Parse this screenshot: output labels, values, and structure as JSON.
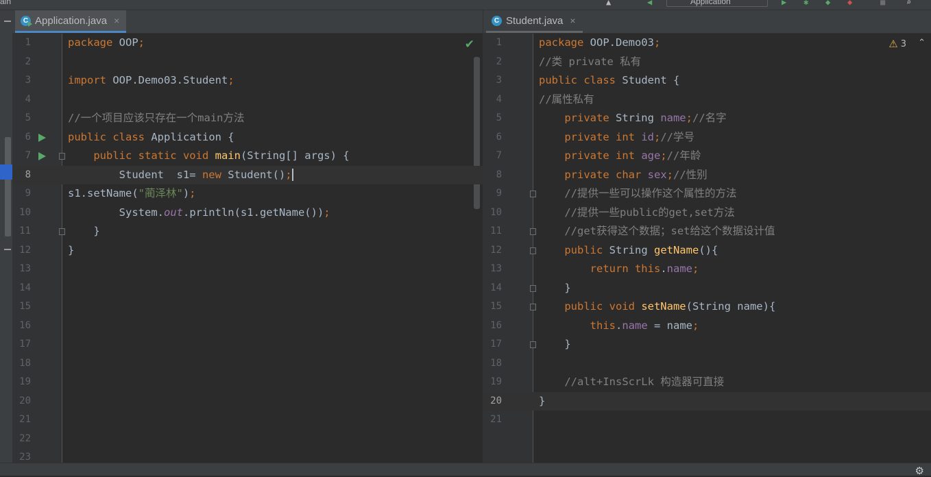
{
  "topbar": {
    "left_fragment": "ain",
    "run_config": "Application",
    "icons": [
      "hammer-icon",
      "back-arrow-icon",
      "run-icon",
      "debug-icon",
      "coverage-icon",
      "profile-icon",
      "stop-icon",
      "search-icon"
    ]
  },
  "left_editor": {
    "tab": {
      "label": "Application.java",
      "icon": "java-class-runnable-icon",
      "active": true
    },
    "status_icon": "check-icon",
    "current_line": 8,
    "run_lines": [
      6,
      7
    ],
    "fold_lines": [
      7,
      11
    ],
    "lines": [
      {
        "n": "1",
        "tokens": [
          [
            "kw",
            "package "
          ],
          [
            "",
            "OOP"
          ],
          [
            "kw",
            ";"
          ]
        ]
      },
      {
        "n": "2",
        "tokens": []
      },
      {
        "n": "3",
        "tokens": [
          [
            "kw",
            "import "
          ],
          [
            "",
            "OOP.Demo03.Student"
          ],
          [
            "kw",
            ";"
          ]
        ]
      },
      {
        "n": "4",
        "tokens": []
      },
      {
        "n": "5",
        "tokens": [
          [
            "cm",
            "//一个项目应该只存在一个main方法"
          ]
        ]
      },
      {
        "n": "6",
        "tokens": [
          [
            "kw",
            "public class "
          ],
          [
            "",
            "Application {"
          ]
        ]
      },
      {
        "n": "7",
        "tokens": [
          [
            "",
            "    "
          ],
          [
            "kw",
            "public static void "
          ],
          [
            "fn",
            "main"
          ],
          [
            "",
            "(String[] args) {"
          ]
        ]
      },
      {
        "n": "8",
        "tokens": [
          [
            "",
            "        Student  s1= "
          ],
          [
            "kw",
            "new "
          ],
          [
            "",
            "Student()"
          ],
          [
            "kw",
            ";"
          ]
        ],
        "caret": true
      },
      {
        "n": "9",
        "tokens": [
          [
            "",
            "s1.setName("
          ],
          [
            "st",
            "\"蔺泽林\""
          ],
          [
            "",
            ")"
          ],
          [
            "kw",
            ";"
          ]
        ]
      },
      {
        "n": "10",
        "tokens": [
          [
            "",
            "        System."
          ],
          [
            "sfld",
            "out"
          ],
          [
            "",
            ".println(s1.getName())"
          ],
          [
            "kw",
            ";"
          ]
        ]
      },
      {
        "n": "11",
        "tokens": [
          [
            "",
            "    }"
          ]
        ]
      },
      {
        "n": "12",
        "tokens": [
          [
            "",
            "}"
          ]
        ]
      },
      {
        "n": "13",
        "tokens": []
      },
      {
        "n": "14",
        "tokens": []
      },
      {
        "n": "15",
        "tokens": []
      },
      {
        "n": "16",
        "tokens": []
      },
      {
        "n": "17",
        "tokens": []
      },
      {
        "n": "18",
        "tokens": []
      },
      {
        "n": "19",
        "tokens": []
      },
      {
        "n": "20",
        "tokens": []
      },
      {
        "n": "21",
        "tokens": []
      },
      {
        "n": "22",
        "tokens": []
      },
      {
        "n": "23",
        "tokens": []
      }
    ]
  },
  "right_editor": {
    "tab": {
      "label": "Student.java",
      "icon": "java-class-icon",
      "active": false
    },
    "warning_count": "3",
    "current_line": 20,
    "run_lines": [],
    "fold_lines": [
      9,
      11,
      12,
      14,
      15,
      17
    ],
    "lines": [
      {
        "n": "1",
        "tokens": [
          [
            "kw",
            "package "
          ],
          [
            "",
            "OOP.Demo03"
          ],
          [
            "kw",
            ";"
          ]
        ]
      },
      {
        "n": "2",
        "tokens": [
          [
            "cm",
            "//类 private 私有"
          ]
        ]
      },
      {
        "n": "3",
        "tokens": [
          [
            "kw",
            "public class "
          ],
          [
            "",
            "Student {"
          ]
        ]
      },
      {
        "n": "4",
        "tokens": [
          [
            "cm",
            "//属性私有"
          ]
        ]
      },
      {
        "n": "5",
        "tokens": [
          [
            "",
            "    "
          ],
          [
            "kw",
            "private "
          ],
          [
            "",
            "String "
          ],
          [
            "fld",
            "name"
          ],
          [
            "kw",
            ";"
          ],
          [
            "cm",
            "//名字"
          ]
        ]
      },
      {
        "n": "6",
        "tokens": [
          [
            "",
            "    "
          ],
          [
            "kw",
            "private int "
          ],
          [
            "fld",
            "id"
          ],
          [
            "kw",
            ";"
          ],
          [
            "cm",
            "//学号"
          ]
        ]
      },
      {
        "n": "7",
        "tokens": [
          [
            "",
            "    "
          ],
          [
            "kw",
            "private int "
          ],
          [
            "fld",
            "age"
          ],
          [
            "kw",
            ";"
          ],
          [
            "cm",
            "//年龄"
          ]
        ]
      },
      {
        "n": "8",
        "tokens": [
          [
            "",
            "    "
          ],
          [
            "kw",
            "private char "
          ],
          [
            "fld",
            "sex"
          ],
          [
            "kw",
            ";"
          ],
          [
            "cm",
            "//性别"
          ]
        ]
      },
      {
        "n": "9",
        "tokens": [
          [
            "",
            "    "
          ],
          [
            "cm",
            "//提供一些可以操作这个属性的方法"
          ]
        ]
      },
      {
        "n": "10",
        "tokens": [
          [
            "",
            "    "
          ],
          [
            "cm",
            "//提供一些public的get,set方法"
          ]
        ]
      },
      {
        "n": "11",
        "tokens": [
          [
            "",
            "    "
          ],
          [
            "cm",
            "//get获得这个数据；set给这个数据设计值"
          ]
        ]
      },
      {
        "n": "12",
        "tokens": [
          [
            "",
            "    "
          ],
          [
            "kw",
            "public "
          ],
          [
            "",
            "String "
          ],
          [
            "fn",
            "getName"
          ],
          [
            "",
            "(){"
          ]
        ]
      },
      {
        "n": "13",
        "tokens": [
          [
            "",
            "        "
          ],
          [
            "kw",
            "return this"
          ],
          [
            "",
            "."
          ],
          [
            "fld",
            "name"
          ],
          [
            "kw",
            ";"
          ]
        ]
      },
      {
        "n": "14",
        "tokens": [
          [
            "",
            "    }"
          ]
        ]
      },
      {
        "n": "15",
        "tokens": [
          [
            "",
            "    "
          ],
          [
            "kw",
            "public void "
          ],
          [
            "fn",
            "setName"
          ],
          [
            "",
            "(String name){"
          ]
        ]
      },
      {
        "n": "16",
        "tokens": [
          [
            "",
            "        "
          ],
          [
            "kw",
            "this"
          ],
          [
            "",
            "."
          ],
          [
            "fld",
            "name"
          ],
          [
            "",
            " = name"
          ],
          [
            "kw",
            ";"
          ]
        ]
      },
      {
        "n": "17",
        "tokens": [
          [
            "",
            "    }"
          ]
        ]
      },
      {
        "n": "18",
        "tokens": []
      },
      {
        "n": "19",
        "tokens": [
          [
            "",
            "    "
          ],
          [
            "cm",
            "//alt+InsScrLk 构造器可直接"
          ]
        ]
      },
      {
        "n": "20",
        "tokens": [
          [
            "",
            "}"
          ]
        ]
      },
      {
        "n": "21",
        "tokens": []
      }
    ]
  }
}
